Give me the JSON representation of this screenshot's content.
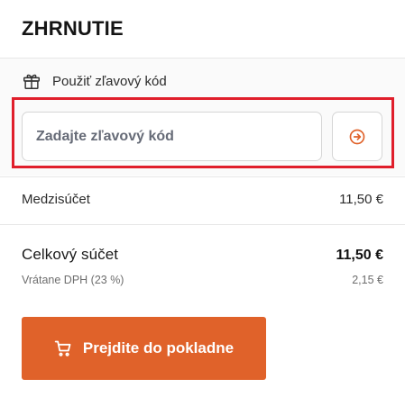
{
  "summary": {
    "title": "ZHRNUTIE"
  },
  "promo": {
    "toggle_label": "Použiť zľavový kód",
    "input_placeholder": "Zadajte zľavový kód",
    "input_value": "",
    "toggle_icon": "gift-icon",
    "apply_icon": "arrow-right-circle-icon"
  },
  "subtotal": {
    "label": "Medzisúčet",
    "value": "11,50 €"
  },
  "total": {
    "label": "Celkový súčet",
    "value": "11,50 €"
  },
  "vat": {
    "label": "Vrátane DPH (23 %)",
    "value": "2,15 €"
  },
  "checkout": {
    "label": "Prejdite do pokladne",
    "icon": "cart-icon"
  },
  "colors": {
    "accent": "#e0622a",
    "highlight": "#e01e2b",
    "panel_background": "#fafafa"
  }
}
